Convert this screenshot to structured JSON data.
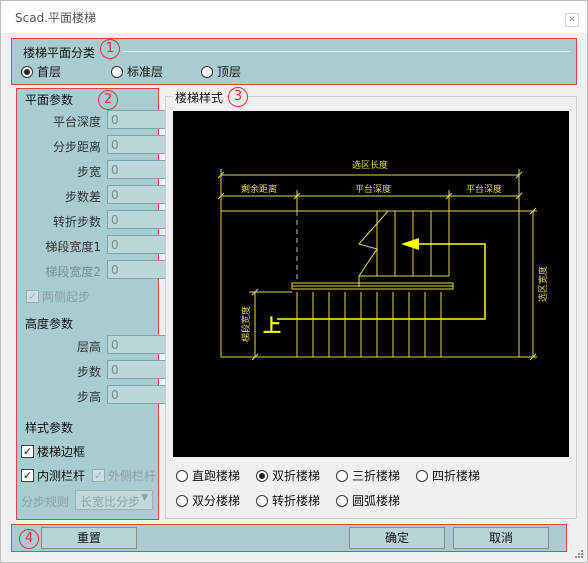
{
  "window": {
    "title": "Scad.平面楼梯",
    "close_icon": "close-icon"
  },
  "floor_class": {
    "badge": "1",
    "legend": "楼梯平面分类",
    "options": [
      {
        "label": "首层",
        "checked": true
      },
      {
        "label": "标准层",
        "checked": false
      },
      {
        "label": "顶层",
        "checked": false
      }
    ]
  },
  "params": {
    "badge": "2",
    "plane_legend": "平面参数",
    "plane_fields": [
      {
        "label": "平台深度",
        "value": "0",
        "disabled": false
      },
      {
        "label": "分步距离",
        "value": "0",
        "disabled": false
      },
      {
        "label": "步宽",
        "value": "0",
        "disabled": false
      },
      {
        "label": "步数差",
        "value": "0",
        "disabled": false
      },
      {
        "label": "转折步数",
        "value": "0",
        "disabled": false
      },
      {
        "label": "梯段宽度1",
        "value": "0",
        "disabled": false
      },
      {
        "label": "梯段宽度2",
        "value": "0",
        "disabled": true
      }
    ],
    "both_sides": {
      "label": "两侧起步",
      "checked": true,
      "disabled": true
    },
    "height_legend": "高度参数",
    "height_fields": [
      {
        "label": "层高",
        "value": "0"
      },
      {
        "label": "步数",
        "value": "0"
      },
      {
        "label": "步高",
        "value": "0"
      }
    ],
    "style_legend": "样式参数",
    "stair_frame": {
      "label": "楼梯边框",
      "checked": true
    },
    "inner_rail": {
      "label": "内测栏杆",
      "checked": true
    },
    "outer_rail": {
      "label": "外侧栏杆",
      "checked": true,
      "disabled": true
    },
    "step_rule_label": "分步规则",
    "step_rule_value": "长宽比分步"
  },
  "style": {
    "badge": "3",
    "legend": "楼梯样式",
    "drawing_labels": {
      "total_length": "选区长度",
      "remaining": "剩余距离",
      "platform_depth_1": "平台深度",
      "platform_depth_2": "平台深度",
      "selection_width": "选区宽度",
      "flight_width": "梯段宽度",
      "up": "上"
    },
    "types": [
      {
        "label": "直跑楼梯",
        "checked": false
      },
      {
        "label": "双折楼梯",
        "checked": true
      },
      {
        "label": "三折楼梯",
        "checked": false
      },
      {
        "label": "四折楼梯",
        "checked": false
      },
      {
        "label": "双分楼梯",
        "checked": false
      },
      {
        "label": "转折楼梯",
        "checked": false
      },
      {
        "label": "圆弧楼梯",
        "checked": false
      }
    ]
  },
  "footer": {
    "badge": "4",
    "reset": "重置",
    "ok": "确定",
    "cancel": "取消"
  },
  "colors": {
    "panel": "#a8ccd0",
    "highlight_border": "#d84a4a",
    "cad_line": "#e8d84a",
    "cad_bg": "#000000"
  }
}
